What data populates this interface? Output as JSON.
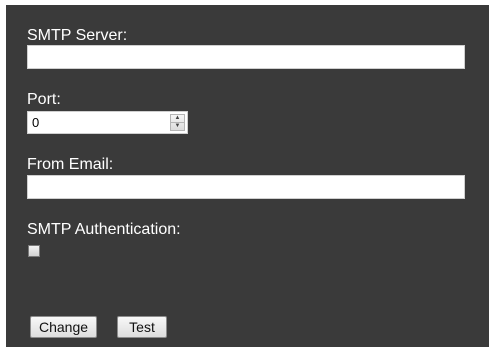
{
  "form": {
    "smtp_server": {
      "label": "SMTP Server:",
      "value": ""
    },
    "port": {
      "label": "Port:",
      "value": "0"
    },
    "from_email": {
      "label": "From Email:",
      "value": ""
    },
    "smtp_auth": {
      "label": "SMTP Authentication:",
      "checked": false
    }
  },
  "buttons": {
    "change_label": "Change",
    "test_label": "Test"
  },
  "icons": {
    "spinner_up": "chevron-up-icon",
    "spinner_down": "chevron-down-icon"
  },
  "colors": {
    "panel_bg": "#3a3a3a",
    "label_text": "#ffffff"
  }
}
